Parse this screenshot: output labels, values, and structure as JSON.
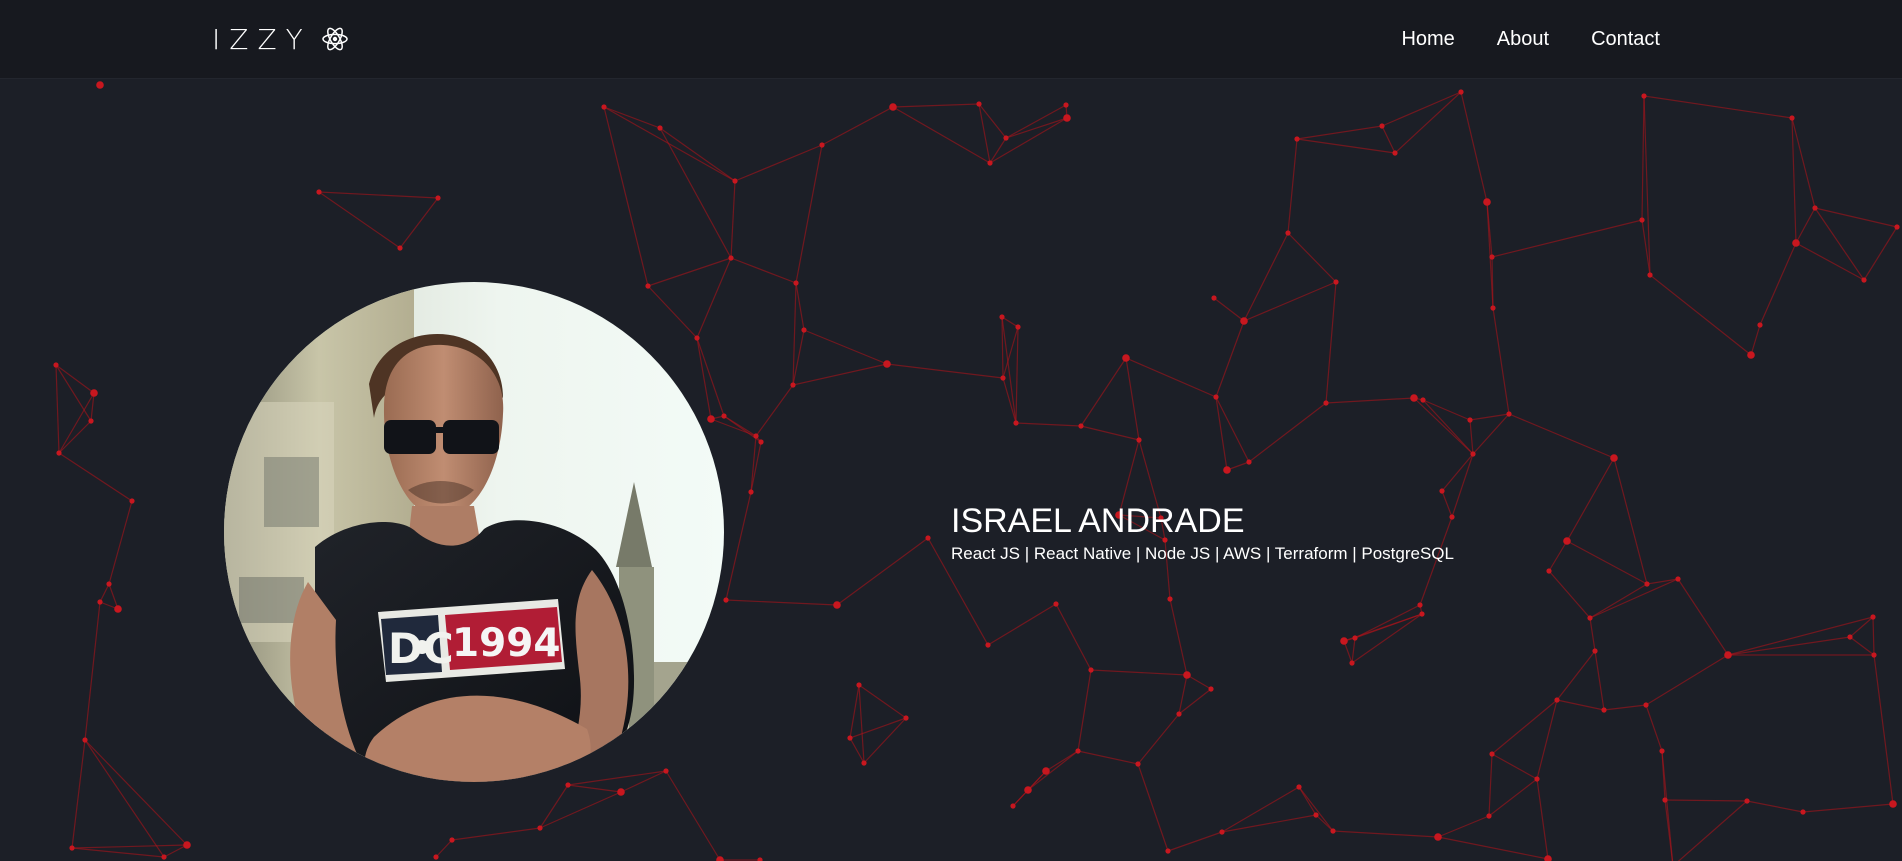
{
  "header": {
    "brand": "IZZY",
    "brand_icon": "react-atom-icon",
    "nav": [
      {
        "label": "Home"
      },
      {
        "label": "About"
      },
      {
        "label": "Contact"
      }
    ]
  },
  "hero": {
    "name": "ISRAEL ANDRADE",
    "stack": "React JS | React Native | Node JS | AWS | Terraform | PostgreSQL",
    "portrait_icon": "profile-photo"
  },
  "theme": {
    "background": "#1c1f27",
    "navbar": "#17191f",
    "accent": "#c8171f",
    "text": "#ffffff"
  }
}
